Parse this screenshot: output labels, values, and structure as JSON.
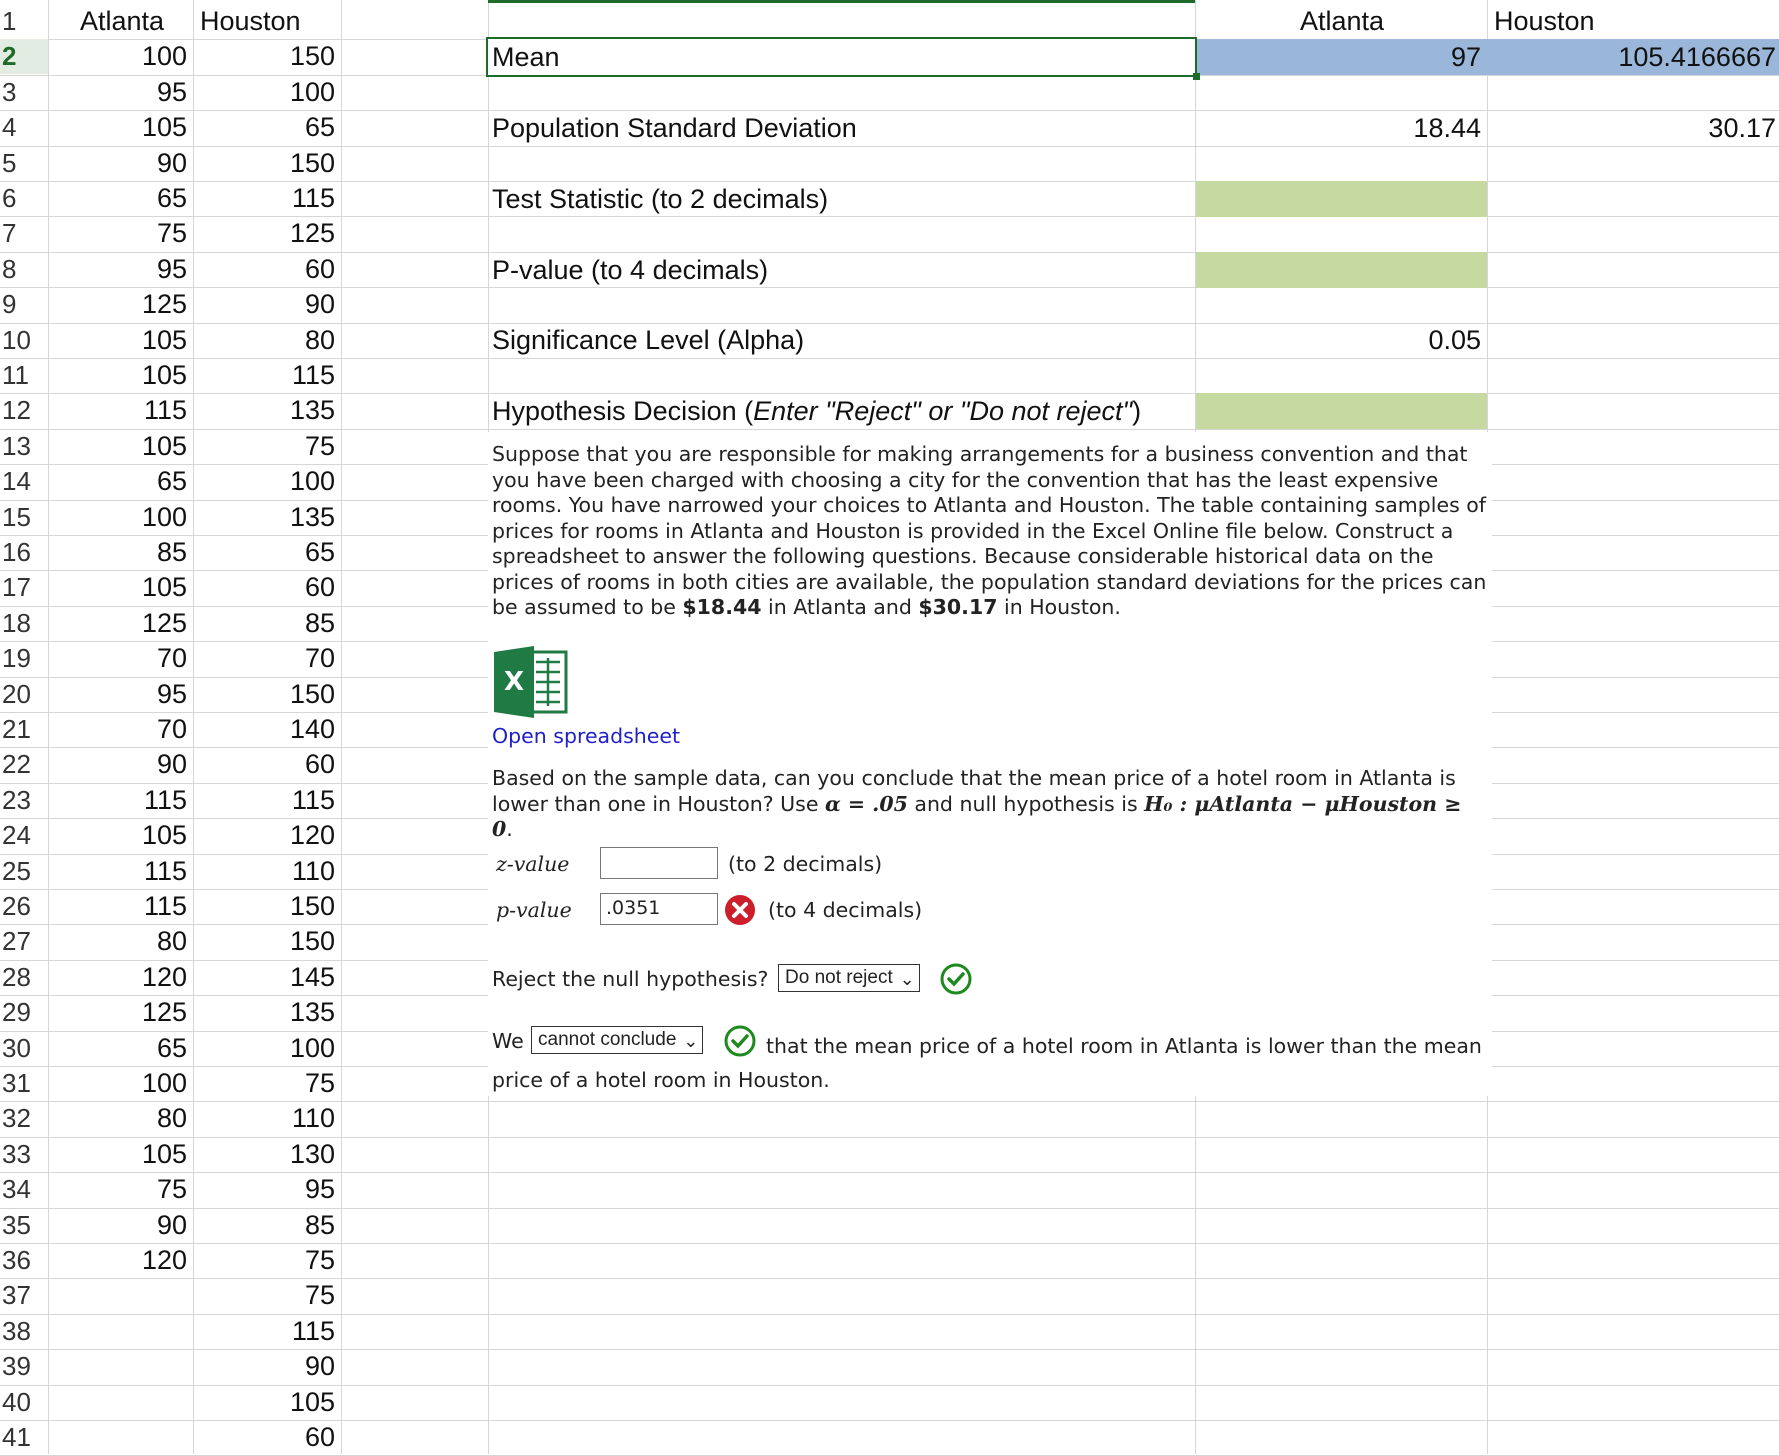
{
  "columns": {
    "atlanta": "Atlanta",
    "houston": "Houston"
  },
  "row_numbers": [
    "1",
    "2",
    "3",
    "4",
    "5",
    "6",
    "7",
    "8",
    "9",
    "10",
    "11",
    "12",
    "13",
    "14",
    "15",
    "16",
    "17",
    "18",
    "19",
    "20",
    "21",
    "22",
    "23",
    "24",
    "25",
    "26",
    "27",
    "28",
    "29",
    "30",
    "31",
    "32",
    "33",
    "34",
    "35",
    "36",
    "37",
    "38",
    "39",
    "40",
    "41"
  ],
  "atlanta_values": [
    "100",
    "95",
    "105",
    "90",
    "65",
    "75",
    "95",
    "125",
    "105",
    "105",
    "115",
    "105",
    "65",
    "100",
    "85",
    "105",
    "125",
    "70",
    "95",
    "70",
    "90",
    "115",
    "105",
    "115",
    "115",
    "80",
    "120",
    "125",
    "65",
    "100",
    "80",
    "105",
    "75",
    "90",
    "120"
  ],
  "houston_values": [
    "150",
    "100",
    "65",
    "150",
    "115",
    "125",
    "60",
    "90",
    "80",
    "115",
    "135",
    "75",
    "100",
    "135",
    "65",
    "60",
    "85",
    "70",
    "150",
    "140",
    "60",
    "115",
    "120",
    "110",
    "150",
    "150",
    "145",
    "135",
    "100",
    "75",
    "110",
    "130",
    "95",
    "85",
    "75",
    "75",
    "115",
    "90",
    "105",
    "60"
  ],
  "summary": {
    "mean_label": "Mean",
    "mean_atlanta": "97",
    "mean_houston": "105.4166667",
    "sd_label": "Population Standard Deviation",
    "sd_atlanta": "18.44",
    "sd_houston": "30.17",
    "test_stat_label": "Test Statistic (to 2 decimals)",
    "pvalue_label": "P-value (to 4 decimals)",
    "alpha_label": "Significance Level (Alpha)",
    "alpha_value": "0.05",
    "decision_label": "Hypothesis Decision (",
    "decision_hint": "Enter \"Reject\" or \"Do not reject\"",
    "decision_close": ")"
  },
  "problem": {
    "paragraph_a": "Suppose that you are responsible for making arrangements for a business convention and that you have been charged with choosing a city for the convention that has the least expensive rooms. You have narrowed your choices to Atlanta and Houston. The table containing samples of prices for rooms in Atlanta and Houston is provided in the Excel Online file below. Construct a spreadsheet to answer the following questions. Because considerable historical data on the prices of rooms in both cities are available, the population standard deviations for the prices can be assumed to be ",
    "sd_atlanta_bold": "$18.44",
    "in_atlanta_and": " in Atlanta and ",
    "sd_houston_bold": "$30.17",
    "in_houston": " in Houston.",
    "open_spreadsheet": "Open spreadsheet",
    "question_a": "Based on the sample data, can you conclude that the mean price of a hotel room in Atlanta is lower than one in Houston? Use ",
    "alpha_sym": "α = .05",
    "question_b": " and null hypothesis is ",
    "h0_text": "H₀ : μAtlanta − μHouston ≥ 0",
    "period": ".",
    "z_label": "z-value",
    "z_value": "",
    "z_hint": "(to 2 decimals)",
    "p_label": "p-value",
    "p_value": ".0351",
    "p_hint": "(to 4 decimals)",
    "reject_question": "Reject the null hypothesis?",
    "reject_selected": "Do not reject",
    "we_label": "We",
    "conclude_selected": "cannot conclude",
    "conclusion_text": "that the mean price of a hotel room in Atlanta is lower than the mean price of a hotel room in Houston."
  },
  "colors": {
    "selected_row": "#1d6b2a",
    "mean_fill": "#9ab6d9",
    "answer_fill": "#c5d9a0",
    "wrong": "#cc1f2b",
    "correct": "#1e8a1e",
    "excel_green": "#1f7a44"
  },
  "icons": [
    "excel-icon",
    "wrong-x-icon",
    "correct-check-icon",
    "chevron-down-icon"
  ]
}
